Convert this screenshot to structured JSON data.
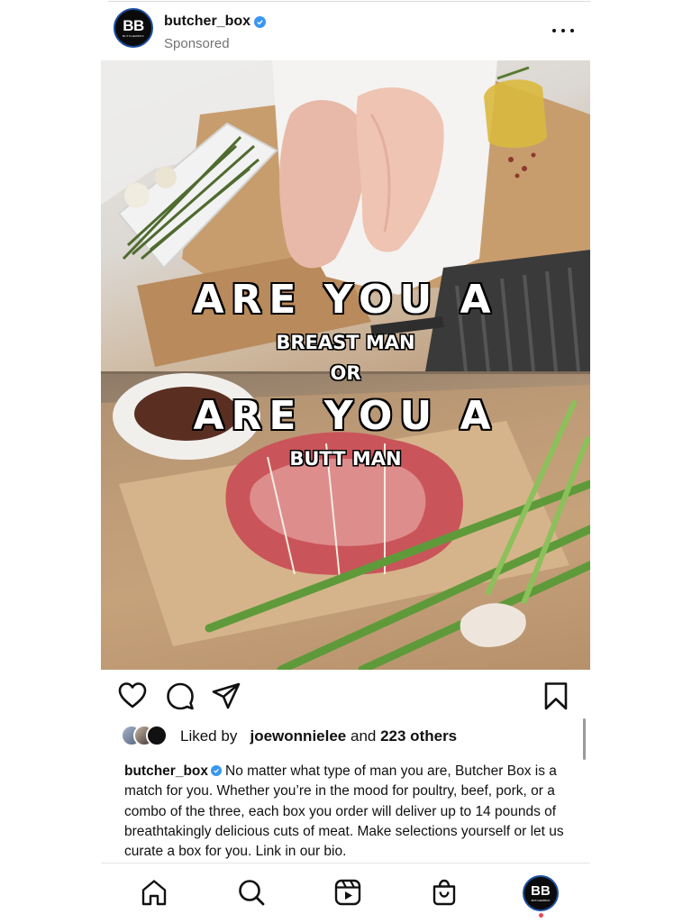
{
  "account": {
    "username": "butcher_box",
    "sponsored_label": "Sponsored",
    "avatar_text": "BB",
    "avatar_subtext": "BUTCHERBOX"
  },
  "image": {
    "line1": "ARE YOU A",
    "line2": "BREAST MAN",
    "line3": "OR",
    "line4": "ARE YOU A",
    "line5": "BUTT MAN"
  },
  "likes": {
    "prefix": "Liked by",
    "user": "joewonnielee",
    "middle": "and",
    "count": "223 others"
  },
  "caption": {
    "user": "butcher_box",
    "text": "No matter what type of man you are, Butcher Box is a match for you. Whether you’re in the mood for poultry, beef, pork, or a combo of the three, each box you order will deliver up to 14 pounds of breathtakingly delicious cuts of meat. Make selections yourself or let us curate a box for you. Link in our bio."
  },
  "nav": {
    "items": [
      "home-icon",
      "search-icon",
      "reels-icon",
      "shop-icon",
      "profile-avatar"
    ]
  },
  "colors": {
    "verified": "#3897f0",
    "notification_dot": "#ed4956",
    "secondary_text": "#737373"
  }
}
